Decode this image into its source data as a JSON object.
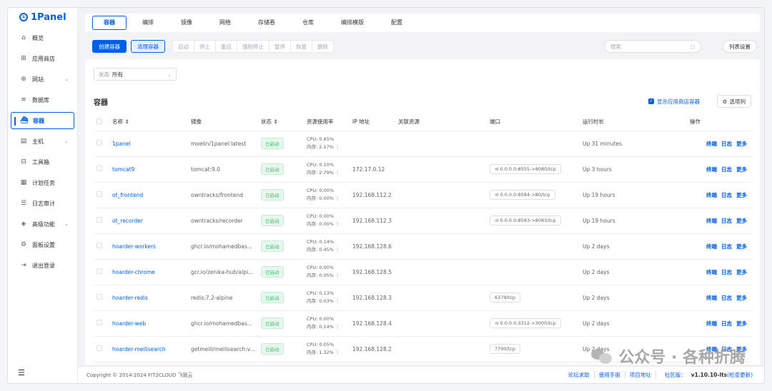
{
  "app": {
    "logo_text": "1Panel"
  },
  "sidebar": {
    "items": [
      {
        "label": "概览",
        "icon": "home-icon",
        "icon_glyph": "⌂"
      },
      {
        "label": "应用商店",
        "icon": "grid-icon",
        "icon_glyph": "⊞"
      },
      {
        "label": "网站",
        "icon": "globe-icon",
        "icon_glyph": "⊕",
        "expandable": true
      },
      {
        "label": "数据库",
        "icon": "database-icon",
        "icon_glyph": "≋"
      },
      {
        "label": "容器",
        "icon": "container-icon",
        "icon_glyph": "⛴",
        "active": true
      },
      {
        "label": "主机",
        "icon": "host-icon",
        "icon_glyph": "▤",
        "expandable": true
      },
      {
        "label": "工具箱",
        "icon": "toolbox-icon",
        "icon_glyph": "⊟"
      },
      {
        "label": "计划任务",
        "icon": "calendar-icon",
        "icon_glyph": "▦"
      },
      {
        "label": "日志审计",
        "icon": "log-icon",
        "icon_glyph": "☰"
      },
      {
        "label": "高级功能",
        "icon": "diamond-icon",
        "icon_glyph": "◈",
        "expandable": true
      },
      {
        "label": "面板设置",
        "icon": "settings-icon",
        "icon_glyph": "⚙"
      },
      {
        "label": "退出登录",
        "icon": "logout-icon",
        "icon_glyph": "⇥"
      }
    ],
    "collapse_glyph": "☰"
  },
  "tabs": [
    "容器",
    "编排",
    "镜像",
    "网络",
    "存储卷",
    "仓库",
    "编排模版",
    "配置"
  ],
  "toolbar": {
    "create": "创建容器",
    "clean": "清理容器",
    "actions": [
      "启动",
      "停止",
      "重启",
      "强制停止",
      "暂停",
      "恢复",
      "删除"
    ],
    "search_placeholder": "搜索",
    "column_settings": "列表设置"
  },
  "filter": {
    "label": "状态",
    "value": "所有"
  },
  "table": {
    "title": "容器",
    "show_app_containers": "显示应用商店容器",
    "select_columns": "选项列",
    "headers": [
      "名称 ⇕",
      "镜像",
      "状态 ⇕",
      "资源使用率",
      "IP 地址",
      "关联资源",
      "端口",
      "运行时长",
      "操作"
    ],
    "ops": [
      "终端",
      "日志",
      "更多"
    ],
    "rows": [
      {
        "name": "1panel",
        "image": "moelin/1panel:latest",
        "status": "已启动",
        "cpu": "CPU: 0.65%",
        "mem": "内存: 2.17%",
        "ip": "",
        "port": "",
        "uptime": "Up 31 minutes"
      },
      {
        "name": "tomcat9",
        "image": "tomcat:9.0",
        "status": "已启动",
        "cpu": "CPU: 0.10%",
        "mem": "内存: 2.79%",
        "ip": "172.17.0.12",
        "port": "⊲ 0.0.0.0:8555->8080/tcp",
        "uptime": "Up 3 hours"
      },
      {
        "name": "ot_frontend",
        "image": "owntracks/frontend",
        "status": "已启动",
        "cpu": "CPU: 0.00%",
        "mem": "内存: 0.00%",
        "ip": "192.168.112.2",
        "port": "⊲ 0.0.0.0:8584->80/tcp",
        "uptime": "Up 19 hours"
      },
      {
        "name": "ot_recorder",
        "image": "owntracks/recorder",
        "status": "已启动",
        "cpu": "CPU: 0.00%",
        "mem": "内存: 0.00%",
        "ip": "192.168.112.3",
        "port": "⊲ 0.0.0.0:8583->8083/tcp",
        "uptime": "Up 19 hours"
      },
      {
        "name": "hoarder-workers",
        "image": "ghcr.io/mohamedbas...",
        "status": "已启动",
        "cpu": "CPU: 0.14%",
        "mem": "内存: 0.45%",
        "ip": "192.168.128.6",
        "port": "",
        "uptime": "Up 2 days"
      },
      {
        "name": "hoarder-chrome",
        "image": "gcr.io/zenika-hub/alpi...",
        "status": "已启动",
        "cpu": "CPU: 0.00%",
        "mem": "内存: 0.05%",
        "ip": "192.168.128.5",
        "port": "",
        "uptime": "Up 2 days"
      },
      {
        "name": "hoarder-redis",
        "image": "redis:7.2-alpine",
        "status": "已启动",
        "cpu": "CPU: 0.13%",
        "mem": "内存: 0.03%",
        "ip": "192.168.128.3",
        "port": "6379/tcp",
        "uptime": "Up 2 days"
      },
      {
        "name": "hoarder-web",
        "image": "ghcr.io/mohamedbas...",
        "status": "已启动",
        "cpu": "CPU: 0.00%",
        "mem": "内存: 0.14%",
        "ip": "192.168.128.4",
        "port": "⊲ 0.0.0.0:3312->3000/tcp",
        "uptime": "Up 2 days"
      },
      {
        "name": "hoarder-meilisearch",
        "image": "getmeili/meilisearch:v...",
        "status": "已启动",
        "cpu": "CPU: 0.05%",
        "mem": "内存: 1.32%",
        "ip": "192.168.128.2",
        "port": "7700/tcp",
        "uptime": "Up 2 days"
      }
    ]
  },
  "footer": {
    "copyright": "Copyright © 2014-2024 FIT2CLOUD 飞致云",
    "links": [
      "论坛求助",
      "使用手册",
      "项目地址"
    ],
    "version_label": "社区版：",
    "version": "v1.10.10-lts",
    "check_update": "(检查更新)"
  },
  "watermark": {
    "text": "公众号 · 各种折腾"
  },
  "colors": {
    "accent": "#005eeb",
    "status_green": "#2ec56b"
  }
}
